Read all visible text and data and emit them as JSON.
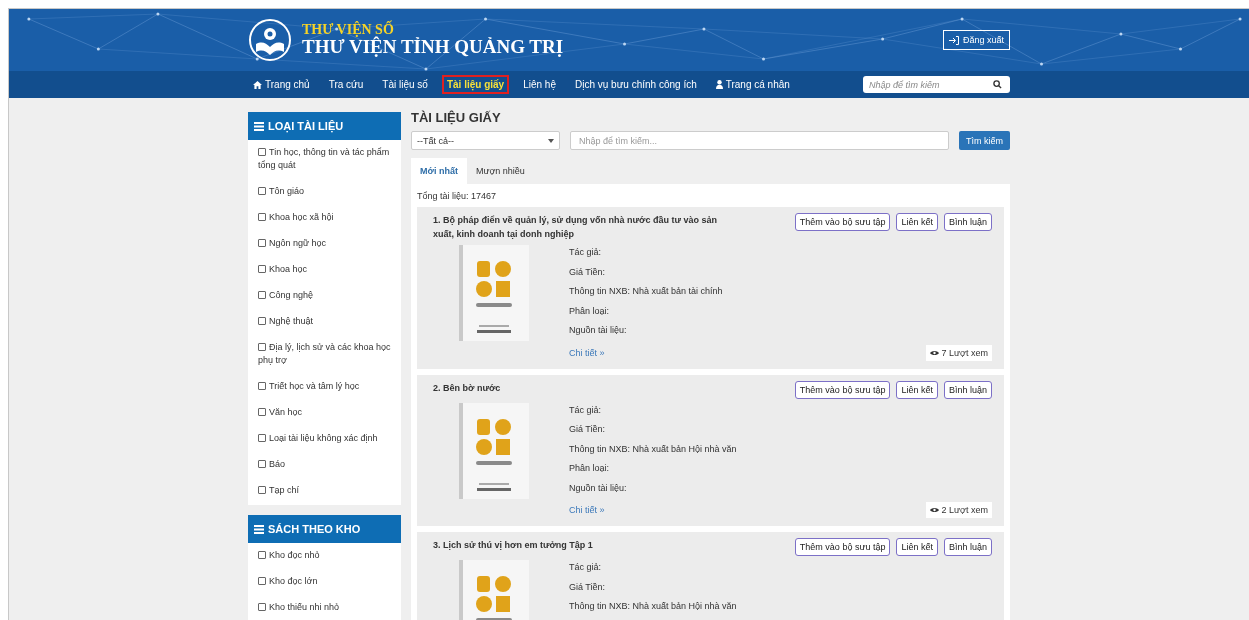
{
  "header": {
    "subtitle": "THƯ VIỆN SỐ",
    "title": "THƯ VIỆN TỈNH QUẢNG TRỊ",
    "logout": "Đăng xuất"
  },
  "nav": {
    "items": [
      {
        "label": "Trang chủ",
        "kind": "home",
        "selected": false
      },
      {
        "label": "Tra cứu",
        "selected": false
      },
      {
        "label": "Tài liệu số",
        "selected": false
      },
      {
        "label": "Tài liệu giấy",
        "selected": true
      },
      {
        "label": "Liên hệ",
        "selected": false
      },
      {
        "label": "Dịch vụ bưu chính công ích",
        "selected": false
      },
      {
        "label": "Trang cá nhân",
        "kind": "user",
        "selected": false
      }
    ],
    "search": {
      "placeholder": "Nhập để tìm kiếm"
    }
  },
  "sidebar": {
    "sections": [
      {
        "title": "LOẠI TÀI LIỆU",
        "items": [
          {
            "label": "Tin học, thông tin và tác phẩm tổng quát",
            "checked": false
          },
          {
            "label": "Tôn giáo",
            "checked": false
          },
          {
            "label": "Khoa học xã hội",
            "checked": false
          },
          {
            "label": "Ngôn ngữ học",
            "checked": false
          },
          {
            "label": "Khoa học",
            "checked": false
          },
          {
            "label": "Công nghệ",
            "checked": false
          },
          {
            "label": "Nghệ thuật",
            "checked": false
          },
          {
            "label": "Địa lý, lịch sử và các khoa học phụ trợ",
            "checked": false
          },
          {
            "label": "Triết học và tâm lý học",
            "checked": false
          },
          {
            "label": "Văn học",
            "checked": false
          },
          {
            "label": "Loại tài liệu không xác định",
            "checked": false
          },
          {
            "label": "Báo",
            "checked": false
          },
          {
            "label": "Tạp chí",
            "checked": false
          }
        ]
      },
      {
        "title": "SÁCH THEO KHO",
        "items": [
          {
            "label": "Kho đọc nhỏ",
            "checked": false
          },
          {
            "label": "Kho đọc lớn",
            "checked": false
          },
          {
            "label": "Kho thiếu nhi nhỏ",
            "checked": false
          }
        ]
      }
    ]
  },
  "main": {
    "title": "TÀI LIỆU GIẤY",
    "filter": {
      "value": "--Tất cả--"
    },
    "search": {
      "placeholder": "Nhập để tìm kiếm..."
    },
    "search_button": "Tìm kiếm",
    "tabs": [
      {
        "label": "Mới nhất",
        "selected": true
      },
      {
        "label": "Mượn nhiều",
        "selected": false
      }
    ],
    "total": "Tổng tài liệu: 17467",
    "books": [
      {
        "title": "1. Bộ pháp điển về quản lý, sử dụng vốn nhà nước đầu tư vào sản xuất, kinh doanh tại donh nghiệp",
        "actions": [
          "Thêm vào bộ sưu tập",
          "Liên kết",
          "Bình luận"
        ],
        "fields": [
          "Tác giả:",
          "Giá Tiền:",
          "Thông tin NXB: Nhà xuất bản tài chính",
          "Phân loại:",
          "Nguồn tài liệu:"
        ],
        "detail": "Chi tiết »",
        "views": "7 Lượt xem"
      },
      {
        "title": "2. Bên bờ nước",
        "actions": [
          "Thêm vào bộ sưu tập",
          "Liên kết",
          "Bình luận"
        ],
        "fields": [
          "Tác giả:",
          "Giá Tiền:",
          "Thông tin NXB: Nhà xuất bản Hội nhà văn",
          "Phân loại:",
          "Nguồn tài liệu:"
        ],
        "detail": "Chi tiết »",
        "views": "2 Lượt xem"
      },
      {
        "title": "3. Lịch sử thú vị hơn em tưởng Tập 1",
        "actions": [
          "Thêm vào bộ sưu tập",
          "Liên kết",
          "Bình luận"
        ],
        "fields": [
          "Tác giả:",
          "Giá Tiền:",
          "Thông tin NXB: Nhà xuất bản Hội nhà văn"
        ]
      }
    ]
  }
}
